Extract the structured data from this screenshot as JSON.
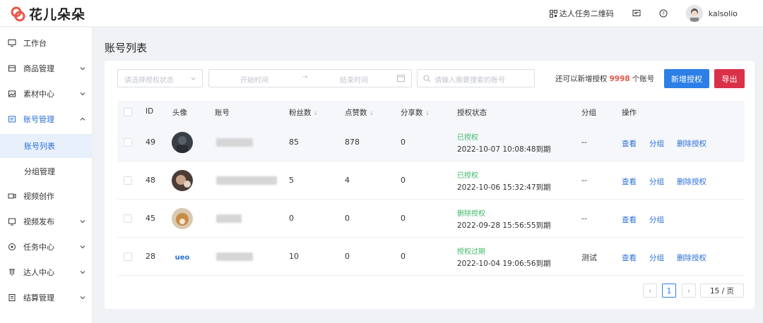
{
  "header": {
    "app_name": "花儿朵朵",
    "qr_label": "达人任务二维码",
    "user_name": "kalsolio",
    "icons": [
      "logo-icon",
      "qr-code-icon",
      "message-icon",
      "help-icon",
      "avatar"
    ]
  },
  "sidebar": {
    "items": [
      {
        "label": "工作台",
        "icon": "monitor-icon"
      },
      {
        "label": "商品管理",
        "icon": "box-icon"
      },
      {
        "label": "素材中心",
        "icon": "image-icon"
      },
      {
        "label": "账号管理",
        "icon": "account-icon"
      },
      {
        "label": "视频创作",
        "icon": "video-icon"
      },
      {
        "label": "视频发布",
        "icon": "publish-icon"
      },
      {
        "label": "任务中心",
        "icon": "task-icon"
      },
      {
        "label": "达人中心",
        "icon": "creator-icon"
      },
      {
        "label": "结算管理",
        "icon": "settlement-icon"
      }
    ],
    "subitems": [
      {
        "label": "账号列表"
      },
      {
        "label": "分组管理"
      }
    ]
  },
  "page": {
    "title": "账号列表"
  },
  "filters": {
    "status_placeholder": "请选择授权状态",
    "start_placeholder": "开始时间",
    "arrow": "→",
    "end_placeholder": "结束时间",
    "search_placeholder": "请输入需要搜索的账号"
  },
  "quota": {
    "prefix": "还可以新增授权",
    "number": "9998",
    "suffix": "个账号"
  },
  "buttons": {
    "add": "新增授权",
    "export": "导出"
  },
  "table": {
    "headers": {
      "id": "ID",
      "avatar": "头像",
      "account": "账号",
      "fans": "粉丝数",
      "likes": "点赞数",
      "shares": "分享数",
      "status": "授权状态",
      "group": "分组",
      "actions": "操作"
    },
    "rows": [
      {
        "id": "49",
        "fans": "85",
        "likes": "878",
        "shares": "0",
        "status": "已授权",
        "expire": "2022-10-07 10:08:48到期",
        "group": "--",
        "actions": [
          "查看",
          "分组",
          "删除授权"
        ]
      },
      {
        "id": "48",
        "fans": "5",
        "likes": "4",
        "shares": "0",
        "status": "已授权",
        "expire": "2022-10-06 15:32:47到期",
        "group": "--",
        "actions": [
          "查看",
          "分组",
          "删除授权"
        ]
      },
      {
        "id": "45",
        "fans": "0",
        "likes": "0",
        "shares": "0",
        "status": "删除授权",
        "expire": "2022-09-28 15:56:55到期",
        "group": "--",
        "actions": [
          "查看",
          "分组"
        ]
      },
      {
        "id": "28",
        "fans": "10",
        "likes": "0",
        "shares": "0",
        "status": "授权过期",
        "expire": "2022-10-04 19:06:56到期",
        "group": "测试",
        "actions": [
          "查看",
          "分组",
          "删除授权"
        ]
      }
    ]
  },
  "pagination": {
    "prev": "‹",
    "current": "1",
    "next": "›",
    "page_size": "15 / 页"
  },
  "colors": {
    "primary": "#2b7fe6",
    "danger": "#d9314a",
    "success": "#3fb96a",
    "accent_red": "#e8564b"
  }
}
